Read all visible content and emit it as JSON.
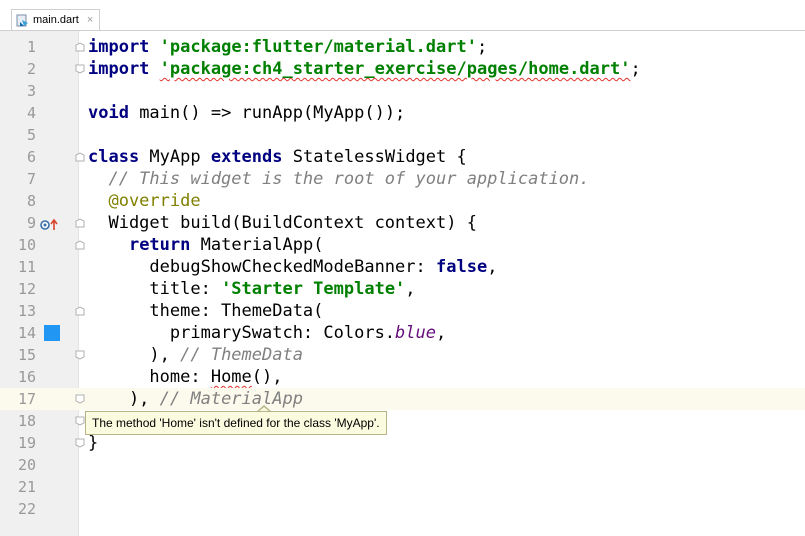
{
  "tab": {
    "filename": "main.dart",
    "close": "×"
  },
  "lines": [
    {
      "num": "1"
    },
    {
      "num": "2"
    },
    {
      "num": "3"
    },
    {
      "num": "4"
    },
    {
      "num": "5"
    },
    {
      "num": "6"
    },
    {
      "num": "7"
    },
    {
      "num": "8"
    },
    {
      "num": "9"
    },
    {
      "num": "10"
    },
    {
      "num": "11"
    },
    {
      "num": "12"
    },
    {
      "num": "13"
    },
    {
      "num": "14"
    },
    {
      "num": "15"
    },
    {
      "num": "16"
    },
    {
      "num": "17"
    },
    {
      "num": "18"
    },
    {
      "num": "19"
    },
    {
      "num": "20"
    },
    {
      "num": "21"
    },
    {
      "num": "22"
    }
  ],
  "code": {
    "l1_kw": "import",
    "l1_str": "'package:flutter/material.dart'",
    "l1_end": ";",
    "l2_kw": "import",
    "l2_str": "'package:ch4_starter_exercise/pages/home.dart'",
    "l2_end": ";",
    "l4_kw": "void",
    "l4_rest": " main() => runApp(MyApp());",
    "l6_kw1": "class",
    "l6_mid": " MyApp ",
    "l6_kw2": "extends",
    "l6_rest": " StatelessWidget {",
    "l7_cmt": "  // This widget is the root of your application.",
    "l8_ann": "  @override",
    "l9": "  Widget build(BuildContext context) {",
    "l10_kw": "return",
    "l10_rest": " MaterialApp(",
    "l11_a": "      debugShowCheckedModeBanner: ",
    "l11_kw": "false",
    "l11_end": ",",
    "l12_a": "      title: ",
    "l12_str": "'Starter Template'",
    "l12_end": ",",
    "l13": "      theme: ThemeData(",
    "l14_a": "        primarySwatch: Colors.",
    "l14_fld": "blue",
    "l14_end": ",",
    "l15_a": "      ), ",
    "l15_cmt": "// ThemeData",
    "l16_a": "      home: ",
    "l16_err": "Home",
    "l16_end": "(),",
    "l17_a": "    ), ",
    "l17_cmt": "// MaterialApp",
    "l18": "  }",
    "l19": "}"
  },
  "tooltip": {
    "text": "The method 'Home' isn't defined for the class 'MyApp'."
  },
  "colors": {
    "swatch": "#2196f3",
    "current_line": "#fcfaed",
    "error_underline": "#e0322b"
  },
  "icons": {
    "tab": "dart-file-icon",
    "line9": "override-method-icon",
    "line14": "color-swatch-icon"
  }
}
